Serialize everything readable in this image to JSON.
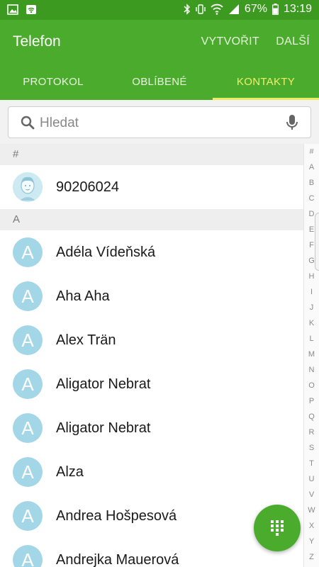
{
  "status_bar": {
    "battery": "67%",
    "time": "13:19"
  },
  "app": {
    "title": "Telefon",
    "actions": {
      "create": "VYTVOŘIT",
      "more": "DALŠÍ"
    }
  },
  "tabs": [
    {
      "label": "PROTOKOL",
      "active": false
    },
    {
      "label": "OBLÍBENÉ",
      "active": false
    },
    {
      "label": "KONTAKTY",
      "active": true
    }
  ],
  "search": {
    "placeholder": "Hledat"
  },
  "sections": [
    {
      "header": "#",
      "contacts": [
        {
          "name": "90206024",
          "avatar": "face-avatar-icon"
        }
      ]
    },
    {
      "header": "A",
      "contacts": [
        {
          "name": "Adéla Vídeňská",
          "initial": "A"
        },
        {
          "name": "Aha Aha",
          "initial": "A"
        },
        {
          "name": "Alex Trän",
          "initial": "A"
        },
        {
          "name": "Aligator Nebrat",
          "initial": "A"
        },
        {
          "name": "Aligator Nebrat",
          "initial": "A"
        },
        {
          "name": "Alza",
          "initial": "A"
        },
        {
          "name": "Andrea Hošpesová",
          "initial": "A"
        },
        {
          "name": "Andrejka Mauerová",
          "initial": "A"
        }
      ]
    }
  ],
  "index": [
    "#",
    "A",
    "B",
    "C",
    "D",
    "E",
    "F",
    "G",
    "H",
    "I",
    "J",
    "K",
    "L",
    "M",
    "N",
    "O",
    "P",
    "Q",
    "R",
    "S",
    "T",
    "U",
    "V",
    "W",
    "X",
    "Y",
    "Z"
  ],
  "colors": {
    "status_bar": "#3c9a20",
    "app_bar": "#4bab2c",
    "active_tab": "#f1ef6a",
    "avatar": "#a3d6e6",
    "fab": "#4bab2c"
  },
  "icons": {
    "search": "search-icon",
    "mic": "mic-icon",
    "fab": "dialpad-icon"
  }
}
